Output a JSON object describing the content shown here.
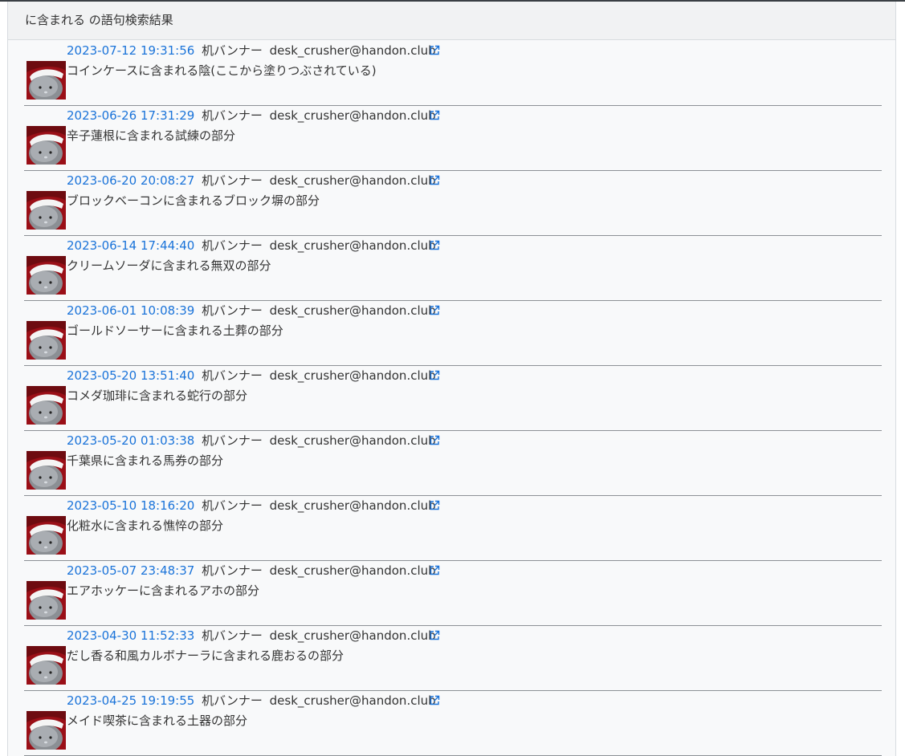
{
  "panel": {
    "title": "に含まれる の語句検索結果"
  },
  "results": [
    {
      "timestamp": "2023-07-12 19:31:56",
      "author": "机バンナー",
      "account": "desk_crusher@handon.club",
      "content": "コインケースに含まれる陰(ここから塗りつぶされている)",
      "link_icon": "external-link-icon"
    },
    {
      "timestamp": "2023-06-26 17:31:29",
      "author": "机バンナー",
      "account": "desk_crusher@handon.club",
      "content": "辛子蓮根に含まれる試練の部分",
      "link_icon": "external-link-icon"
    },
    {
      "timestamp": "2023-06-20 20:08:27",
      "author": "机バンナー",
      "account": "desk_crusher@handon.club",
      "content": "ブロックベーコンに含まれるブロック塀の部分",
      "link_icon": "external-link-icon"
    },
    {
      "timestamp": "2023-06-14 17:44:40",
      "author": "机バンナー",
      "account": "desk_crusher@handon.club",
      "content": "クリームソーダに含まれる無双の部分",
      "link_icon": "external-link-icon"
    },
    {
      "timestamp": "2023-06-01 10:08:39",
      "author": "机バンナー",
      "account": "desk_crusher@handon.club",
      "content": "ゴールドソーサーに含まれる土葬の部分",
      "link_icon": "external-link-icon"
    },
    {
      "timestamp": "2023-05-20 13:51:40",
      "author": "机バンナー",
      "account": "desk_crusher@handon.club",
      "content": "コメダ珈琲に含まれる蛇行の部分",
      "link_icon": "external-link-icon"
    },
    {
      "timestamp": "2023-05-20 01:03:38",
      "author": "机バンナー",
      "account": "desk_crusher@handon.club",
      "content": "千葉県に含まれる馬券の部分",
      "link_icon": "external-link-icon"
    },
    {
      "timestamp": "2023-05-10 18:16:20",
      "author": "机バンナー",
      "account": "desk_crusher@handon.club",
      "content": "化粧水に含まれる憔悴の部分",
      "link_icon": "external-link-icon"
    },
    {
      "timestamp": "2023-05-07 23:48:37",
      "author": "机バンナー",
      "account": "desk_crusher@handon.club",
      "content": "エアホッケーに含まれるアホの部分",
      "link_icon": "external-link-icon"
    },
    {
      "timestamp": "2023-04-30 11:52:33",
      "author": "机バンナー",
      "account": "desk_crusher@handon.club",
      "content": "だし香る和風カルボナーラに含まれる鹿おるの部分",
      "link_icon": "external-link-icon"
    },
    {
      "timestamp": "2023-04-25 19:19:55",
      "author": "机バンナー",
      "account": "desk_crusher@handon.club",
      "content": "メイド喫茶に含まれる土器の部分",
      "link_icon": "external-link-icon"
    }
  ],
  "colors": {
    "timestamp_link": "#1a73d9",
    "text": "#333333",
    "panel_bg": "#f8f9fa",
    "header_bg": "#f1f2f3",
    "avatar_bg": "#9a0f17"
  }
}
